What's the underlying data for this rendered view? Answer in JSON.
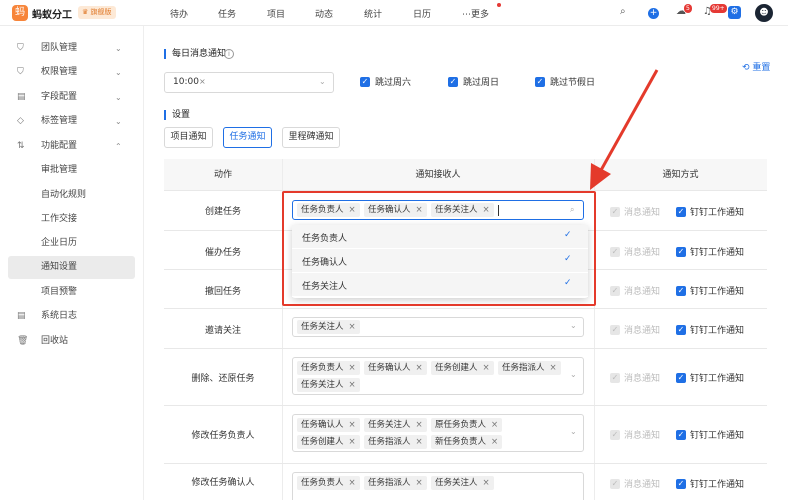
{
  "app": {
    "logo_glyph": "蚂",
    "brand": "蚂蚁分工",
    "badge": "♛ 旗舰版"
  },
  "nav": [
    "待办",
    "任务",
    "项目",
    "动态",
    "统计",
    "日历",
    "⋯更多"
  ],
  "topicons": {
    "search": "⌕",
    "plus": "+",
    "notif1_count": "5",
    "notif2_count": "99+",
    "avatar": "☻"
  },
  "sidebar": [
    {
      "icon": "⛉",
      "label": "团队管理",
      "chevron": "⌄"
    },
    {
      "icon": "⛉",
      "label": "权限管理",
      "chevron": "⌄"
    },
    {
      "icon": "▤",
      "label": "字段配置",
      "chevron": "⌄"
    },
    {
      "icon": "◇",
      "label": "标签管理",
      "chevron": "⌄"
    },
    {
      "icon": "⇅",
      "label": "功能配置",
      "chevron": "⌃"
    },
    {
      "label": "审批管理"
    },
    {
      "label": "自动化规则"
    },
    {
      "label": "工作交接"
    },
    {
      "label": "企业日历"
    },
    {
      "label": "通知设置"
    },
    {
      "label": "项目预警"
    },
    {
      "icon": "▤",
      "label": "系统日志"
    },
    {
      "icon": "🗑",
      "label": "回收站"
    }
  ],
  "daily": {
    "title": "每日消息通知",
    "info": "i",
    "time": "10:00",
    "skip": [
      "跳过周六",
      "跳过周日",
      "跳过节假日"
    ],
    "reset": "⟲ 重置"
  },
  "settings": {
    "title": "设置",
    "tabs": [
      "项目通知",
      "任务通知",
      "里程碑通知"
    ]
  },
  "table": {
    "headers": [
      "动作",
      "通知接收人",
      "通知方式"
    ],
    "rows": [
      {
        "action": "创建任务",
        "tags": [
          "任务负责人",
          "任务确认人",
          "任务关注人"
        ]
      },
      {
        "action": "催办任务",
        "tags": []
      },
      {
        "action": "撤回任务",
        "tags": []
      },
      {
        "action": "邀请关注",
        "tags": [
          "任务关注人"
        ]
      },
      {
        "action": "删除、还原任务",
        "tags": [
          "任务负责人",
          "任务确认人",
          "任务创建人",
          "任务指派人",
          "任务关注人"
        ]
      },
      {
        "action": "修改任务负责人",
        "tags": [
          "任务确认人",
          "任务关注人",
          "原任务负责人",
          "任务创建人",
          "任务指派人",
          "新任务负责人"
        ]
      },
      {
        "action": "修改任务确认人",
        "tags": [
          "任务负责人",
          "任务指派人",
          "任务关注人"
        ]
      }
    ],
    "notify_msg": "消息通知",
    "notify_ding": "钉钉工作通知",
    "x": "×",
    "check": "✓"
  },
  "dropdown": {
    "options": [
      "任务负责人",
      "任务确认人",
      "任务关注人"
    ],
    "check": "✓"
  },
  "colors": {
    "accent": "#1f6fe5",
    "annotation": "#e43a2b",
    "brand": "#f7853a"
  }
}
